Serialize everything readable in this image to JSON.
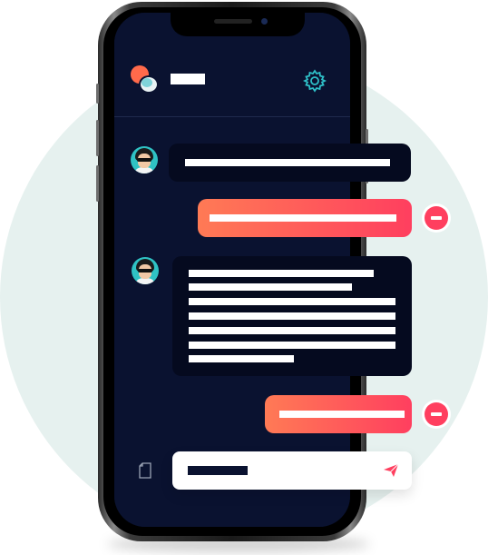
{
  "colors": {
    "background_circle": "#e6f1ef",
    "screen": "#0a1230",
    "incoming_bubble": "#050a1f",
    "outgoing_gradient_start": "#ff7a55",
    "outgoing_gradient_end": "#ff3f5f",
    "accent": "#ff3f5f",
    "avatar": "#2fc2c4"
  },
  "header": {
    "logo_icon": "chat-bubbles-logo-icon",
    "title": "",
    "settings_icon": "gear-icon"
  },
  "messages": [
    {
      "direction": "incoming",
      "avatar_icon": "avatar-icon",
      "lines": [
        ""
      ]
    },
    {
      "direction": "outgoing",
      "lines": [
        ""
      ],
      "action_icon": "minus-circle-icon"
    },
    {
      "direction": "incoming",
      "avatar_icon": "avatar-icon",
      "lines": [
        "",
        "",
        "",
        "",
        "",
        "",
        ""
      ]
    },
    {
      "direction": "outgoing",
      "lines": [
        ""
      ],
      "action_icon": "minus-circle-icon"
    }
  ],
  "composer": {
    "attach_icon": "document-icon",
    "input_value": "",
    "send_icon": "paper-plane-icon"
  }
}
